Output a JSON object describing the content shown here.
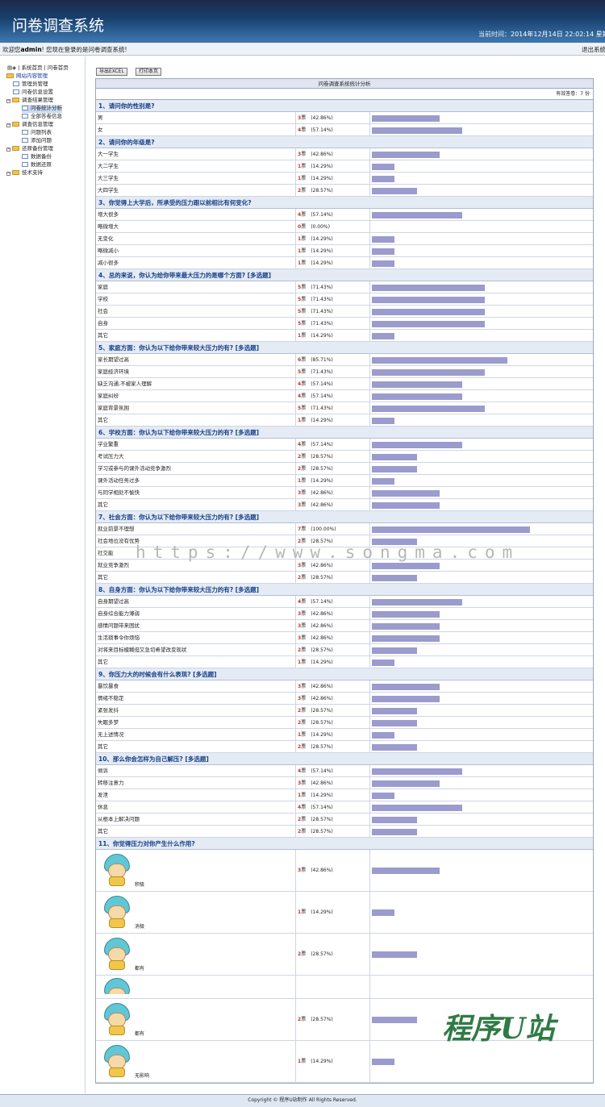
{
  "header": {
    "title": "问卷调查系统",
    "time_label": "当前时间：",
    "time_value": "2014年12月14日  22:02:14 星期日"
  },
  "welcome": {
    "prefix": "欢迎您",
    "user": "admin",
    "suffix": "! 您现在登录的是问卷调查系统!",
    "logout": "退出系统"
  },
  "sidebar": {
    "top": "| 系统首页  | 问卷首页",
    "items": [
      {
        "label": "网站内容管理",
        "kind": "root"
      },
      {
        "label": "管理员管理",
        "kind": "leaf"
      },
      {
        "label": "问卷信息设置",
        "kind": "leaf"
      },
      {
        "label": "调查结果管理",
        "kind": "folder"
      },
      {
        "label": "问卷统计分析",
        "kind": "leaf2",
        "selected": true
      },
      {
        "label": "全部答卷信息",
        "kind": "leaf2"
      },
      {
        "label": "调查信息管理",
        "kind": "folder"
      },
      {
        "label": "问题列表",
        "kind": "leaf2"
      },
      {
        "label": "添加问题",
        "kind": "leaf2"
      },
      {
        "label": "还原备份管理",
        "kind": "folder"
      },
      {
        "label": "数据备份",
        "kind": "leaf2"
      },
      {
        "label": "数据还原",
        "kind": "leaf2"
      },
      {
        "label": "技术支持",
        "kind": "folder"
      }
    ]
  },
  "toolbar": {
    "export": "导出EXCEL",
    "print": "打印本页"
  },
  "report": {
    "title": "问卷调查系统统计分析",
    "count": "有效答卷：7 份"
  },
  "chart_data": {
    "type": "table",
    "questions": [
      {
        "q": "1、请问你的性别是?",
        "rows": [
          [
            "男",
            3,
            "42.86%"
          ],
          [
            "女",
            4,
            "57.14%"
          ]
        ]
      },
      {
        "q": "2、请问你的年级是?",
        "rows": [
          [
            "大一学生",
            3,
            "42.86%"
          ],
          [
            "大二学生",
            1,
            "14.29%"
          ],
          [
            "大三学生",
            1,
            "14.29%"
          ],
          [
            "大四学生",
            2,
            "28.57%"
          ]
        ]
      },
      {
        "q": "3、你觉得上大学后，所承受的压力跟以前相比有何变化?",
        "rows": [
          [
            "增大很多",
            4,
            "57.14%"
          ],
          [
            "略微增大",
            0,
            "0.00%"
          ],
          [
            "无变化",
            1,
            "14.29%"
          ],
          [
            "略微减小",
            1,
            "14.29%"
          ],
          [
            "减小很多",
            1,
            "14.29%"
          ]
        ]
      },
      {
        "q": "4、总的来说，你认为给你带来最大压力的是哪个方面? [多选题]",
        "rows": [
          [
            "家庭",
            5,
            "71.43%"
          ],
          [
            "学校",
            5,
            "71.43%"
          ],
          [
            "社会",
            5,
            "71.43%"
          ],
          [
            "自身",
            5,
            "71.43%"
          ],
          [
            "其它",
            1,
            "14.29%"
          ]
        ]
      },
      {
        "q": "5、家庭方面：你认为以下给你带来较大压力的有? [多选题]",
        "rows": [
          [
            "家长期望过高",
            6,
            "85.71%"
          ],
          [
            "家庭经济环境",
            5,
            "71.43%"
          ],
          [
            "缺乏沟通,不被家人理解",
            4,
            "57.14%"
          ],
          [
            "家庭纠纷",
            4,
            "57.14%"
          ],
          [
            "家庭背景氛围",
            5,
            "71.43%"
          ],
          [
            "其它",
            1,
            "14.29%"
          ]
        ]
      },
      {
        "q": "6、学校方面：你认为以下给你带来较大压力的有? [多选题]",
        "rows": [
          [
            "学业繁重",
            4,
            "57.14%"
          ],
          [
            "考试压力大",
            2,
            "28.57%"
          ],
          [
            "学习或参与的课外活动竞争激烈",
            2,
            "28.57%"
          ],
          [
            "课外活动任务过多",
            1,
            "14.29%"
          ],
          [
            "与同学相处不愉快",
            3,
            "42.86%"
          ],
          [
            "其它",
            3,
            "42.86%"
          ]
        ]
      },
      {
        "q": "7、社会方面：你认为以下给你带来较大压力的有? [多选题]",
        "rows": [
          [
            "就业前景不理想",
            7,
            "100.00%"
          ],
          [
            "社会地位没有优势",
            2,
            "28.57%"
          ],
          [
            "社交能",
            0,
            ""
          ],
          [
            "就业竞争激烈",
            3,
            "42.86%"
          ],
          [
            "其它",
            2,
            "28.57%"
          ]
        ]
      },
      {
        "q": "8、自身方面：你认为以下给你带来较大压力的有? [多选题]",
        "rows": [
          [
            "自身期望过高",
            4,
            "57.14%"
          ],
          [
            "自身综合能力薄弱",
            3,
            "42.86%"
          ],
          [
            "感情问题带来困扰",
            3,
            "42.86%"
          ],
          [
            "生活琐事令你烦恼",
            3,
            "42.86%"
          ],
          [
            "对将来目标模糊但又急切希望改变现状",
            2,
            "28.57%"
          ],
          [
            "其它",
            1,
            "14.29%"
          ]
        ]
      },
      {
        "q": "9、你压力大的时候会有什么表现? [多选题]",
        "rows": [
          [
            "暴饮暴食",
            3,
            "42.86%"
          ],
          [
            "情绪不稳定",
            3,
            "42.86%"
          ],
          [
            "紧张发抖",
            2,
            "28.57%"
          ],
          [
            "失眠多梦",
            2,
            "28.57%"
          ],
          [
            "无上述情况",
            1,
            "14.29%"
          ],
          [
            "其它",
            2,
            "28.57%"
          ]
        ]
      },
      {
        "q": "10、那么你会怎样为自己解压? [多选题]",
        "rows": [
          [
            "倾诉",
            4,
            "57.14%"
          ],
          [
            "转移注意力",
            3,
            "42.86%"
          ],
          [
            "发泄",
            1,
            "14.29%"
          ],
          [
            "休息",
            4,
            "57.14%"
          ],
          [
            "从根本上解决问题",
            2,
            "28.57%"
          ],
          [
            "其它",
            2,
            "28.57%"
          ]
        ]
      },
      {
        "q": "11、你觉得压力对你产生什么作用?",
        "rows": [
          [
            "积极",
            3,
            "42.86%"
          ],
          [
            "消极",
            1,
            "14.29%"
          ],
          [
            "都有",
            2,
            "28.57%"
          ],
          [
            "",
            0,
            ""
          ],
          [
            "都有",
            2,
            "28.57%"
          ],
          [
            "无影响",
            1,
            "14.29%"
          ]
        ]
      }
    ]
  },
  "vote_unit": "票",
  "footer": "Copyright © 程序U站制作  All Rights Reserved.",
  "watermark": "https://www.songma.com",
  "logo_text": "程序U站"
}
